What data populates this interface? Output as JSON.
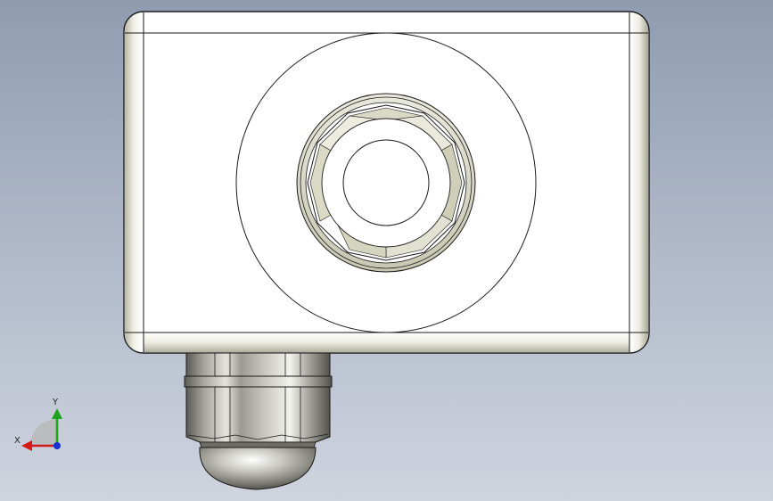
{
  "viewport": {
    "background_top": "#8f9cb0",
    "background_bottom": "#cfd4de"
  },
  "model": {
    "body_color": "#ffffff",
    "outline_color": "#1a1a1a",
    "edge_shade_color": "#d8d8c8",
    "gland_color": "#8a8a82"
  },
  "triad": {
    "x_label": "X",
    "y_label": "Y",
    "x_color": "#d11a1a",
    "y_color": "#1fa31f",
    "z_color": "#1a2fd1"
  }
}
